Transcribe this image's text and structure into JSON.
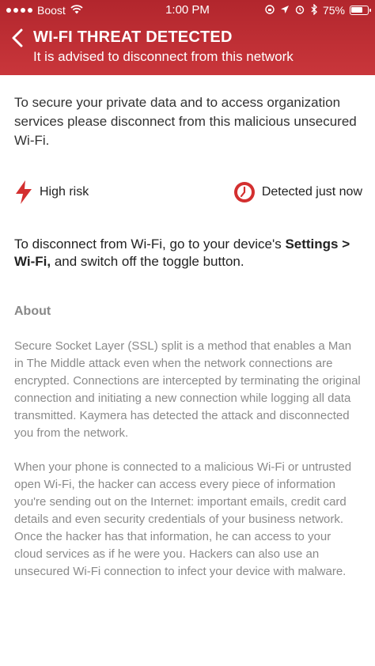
{
  "status_bar": {
    "carrier": "Boost",
    "time": "1:00 PM",
    "battery_percent": "75%",
    "battery_level": 0.75
  },
  "header": {
    "title": "WI-FI THREAT DETECTED",
    "subtitle": "It is advised to disconnect from this network",
    "background_color": "#c0313a"
  },
  "intro_text": "To secure your private data and to access organization services please disconnect from this malicious unsecured Wi-Fi.",
  "risk": {
    "level_label": "High risk",
    "level_icon": "lightning-bolt-icon",
    "detected_label": "Detected just now",
    "detected_icon": "clock-icon",
    "accent_color": "#d32f2f"
  },
  "instructions": {
    "prefix": "To disconnect from Wi-Fi, go to your device's ",
    "path": "Settings > Wi-Fi,",
    "suffix": " and switch off the toggle button."
  },
  "about": {
    "title": "About",
    "paragraph1": "Secure Socket Layer (SSL) split is a method that enables a Man in The Middle attack even when the network connections are encrypted. Connections are intercepted by terminating the original connection and initiating a new connection while logging all data transmitted. Kaymera has detected the attack and disconnected you from the network.",
    "paragraph2": "When your phone is connected to a malicious Wi-Fi or untrusted open Wi-Fi, the hacker can access every piece of information you're sending out on the Internet: important emails, credit card details and even security credentials of your business network. Once the hacker has that information, he can access to your cloud services as if he were you. Hackers can also use an unsecured Wi-Fi connection to infect your device with malware."
  }
}
